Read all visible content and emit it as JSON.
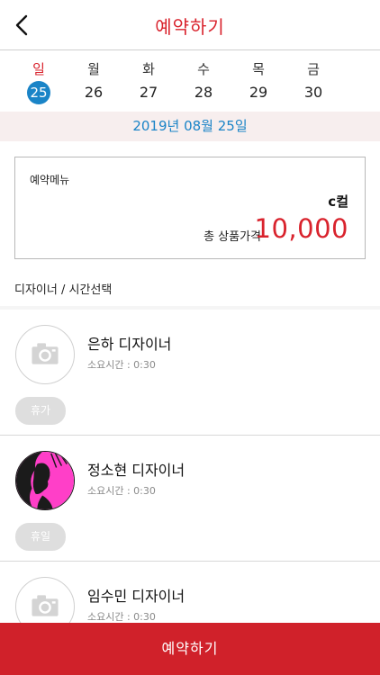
{
  "header": {
    "title": "예약하기",
    "back_icon": "chevron-left-icon"
  },
  "calendar": {
    "days": [
      {
        "name": "일",
        "date": "25",
        "selected": true,
        "is_sunday": true
      },
      {
        "name": "월",
        "date": "26",
        "selected": false,
        "is_sunday": false
      },
      {
        "name": "화",
        "date": "27",
        "selected": false,
        "is_sunday": false
      },
      {
        "name": "수",
        "date": "28",
        "selected": false,
        "is_sunday": false
      },
      {
        "name": "목",
        "date": "29",
        "selected": false,
        "is_sunday": false
      },
      {
        "name": "금",
        "date": "30",
        "selected": false,
        "is_sunday": false
      }
    ],
    "selected_date_text": "2019년 08월 25일"
  },
  "reservation": {
    "menu_label": "예약메뉴",
    "menu_name": "c컬",
    "price_label": "총 상품가격",
    "price": "10,000"
  },
  "designers_section": {
    "label": "디자이너 / 시간선택",
    "designers": [
      {
        "name": "은하 디자이너",
        "duration": "소요시간 : 0:30",
        "status": "휴가",
        "avatar": "camera-placeholder"
      },
      {
        "name": "정소현 디자이너",
        "duration": "소요시간 : 0:30",
        "status": "휴일",
        "avatar": "profile-photo"
      },
      {
        "name": "임수민 디자이너",
        "duration": "소요시간 : 0:30",
        "status": "",
        "avatar": "camera-placeholder"
      }
    ]
  },
  "footer": {
    "reserve_button_label": "예약하기"
  },
  "colors": {
    "accent_red": "#d9232d",
    "selected_blue": "#1a84c7",
    "date_bar_bg": "#f7eeee"
  }
}
